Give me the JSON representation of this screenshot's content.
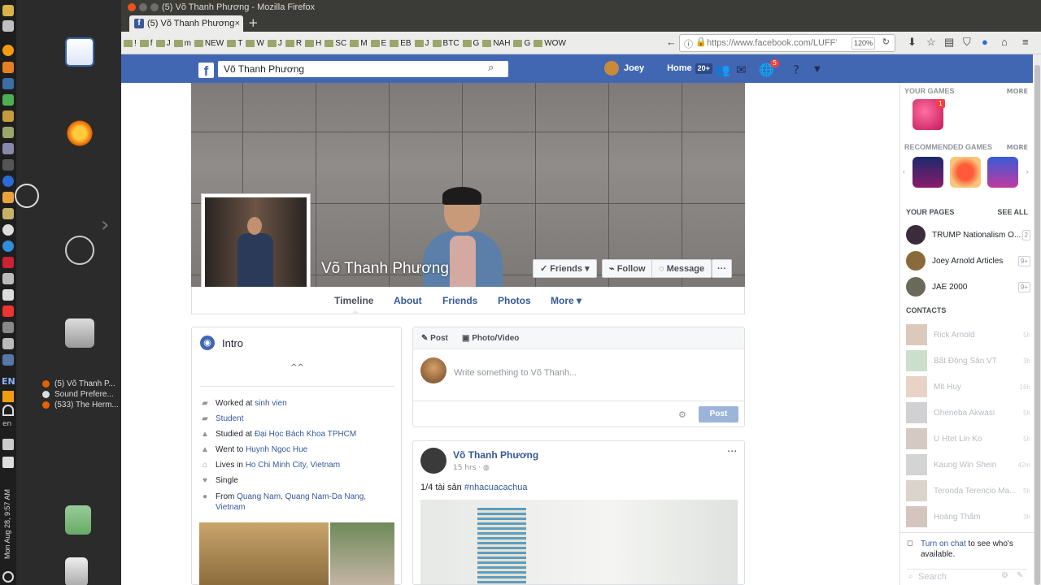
{
  "window": {
    "title": "(5) Võ Thanh Phương - Mozilla Firefox"
  },
  "tab": {
    "label": "(5) Võ Thanh Phương"
  },
  "bookmarks": [
    "!",
    "f",
    "J",
    "m",
    "NEW",
    "T",
    "W",
    "J",
    "R",
    "H",
    "SC",
    "M",
    "E",
    "EB",
    "J",
    "BTC",
    "G",
    "NAH",
    "G",
    "WOW"
  ],
  "url": {
    "value": "https://www.facebook.com/LUFFY",
    "zoom": "120%"
  },
  "dock": {
    "language": "EN",
    "language_small": "en",
    "clock": "Mon Aug 28, 9:57 AM",
    "tasks": [
      "(5) Võ Thanh P...",
      "Sound Prefere...",
      "(533) The Herm..."
    ]
  },
  "topbar": {
    "search_value": "Võ Thanh Phương",
    "user_name": "Joey",
    "home_label": "Home",
    "home_badge": "20+",
    "notif_count": "5"
  },
  "profile": {
    "name": "Võ Thanh Phương",
    "buttons": {
      "friends": "Friends",
      "follow": "Follow",
      "message": "Message",
      "more": "···"
    },
    "tabs": [
      "Timeline",
      "About",
      "Friends",
      "Photos",
      "More"
    ]
  },
  "intro": {
    "title": "Intro",
    "bio": "^^",
    "rows": [
      {
        "prefix": "Worked at ",
        "link": "sinh vien"
      },
      {
        "prefix": "",
        "link": "Student"
      },
      {
        "prefix": "Studied at ",
        "link": "Đại Học Bách Khoa TPHCM"
      },
      {
        "prefix": "Went to ",
        "link": "Huynh Ngoc Hue"
      },
      {
        "prefix": "Lives in ",
        "link": "Ho Chi Minh City, Vietnam"
      },
      {
        "prefix": "Single",
        "link": ""
      },
      {
        "prefix": "From ",
        "link": "Quang Nam, Quang Nam-Da Nang, Vietnam"
      }
    ]
  },
  "composer": {
    "tab_post": "Post",
    "tab_photo": "Photo/Video",
    "placeholder": "Write something to Võ Thanh...",
    "post_button": "Post"
  },
  "post": {
    "author": "Võ Thanh Phương",
    "time": "15 hrs",
    "text": "1/4 tài sản ",
    "hashtag": "#nhacuacachua"
  },
  "rightcol": {
    "your_games": "YOUR GAMES",
    "more": "MORE",
    "recommended_games": "RECOMMENDED GAMES",
    "game_badge": "1",
    "your_pages": "YOUR PAGES",
    "see_all": "SEE ALL",
    "pages": [
      {
        "name": "TRUMP Nationalism O...",
        "count": "2"
      },
      {
        "name": "Joey Arnold Articles",
        "count": "9+"
      },
      {
        "name": "JAE 2000",
        "count": "9+"
      }
    ],
    "contacts_label": "CONTACTS",
    "contacts": [
      {
        "name": "Rick Arnold",
        "time": "5h"
      },
      {
        "name": "Bất Động Sản VT",
        "time": "3h"
      },
      {
        "name": "Mit Huy",
        "time": "16h"
      },
      {
        "name": "Oheneba Akwasi",
        "time": "5h"
      },
      {
        "name": "U Htet Lin Ko",
        "time": "5h"
      },
      {
        "name": "Kaung Win Shein",
        "time": "42m"
      },
      {
        "name": "Teronda Terencio Ma...",
        "time": "5h"
      },
      {
        "name": "Hoàng Thắm",
        "time": "3h"
      }
    ],
    "chat_link": "Turn on chat",
    "chat_rest": " to see who's available.",
    "chat_search": "Search"
  }
}
